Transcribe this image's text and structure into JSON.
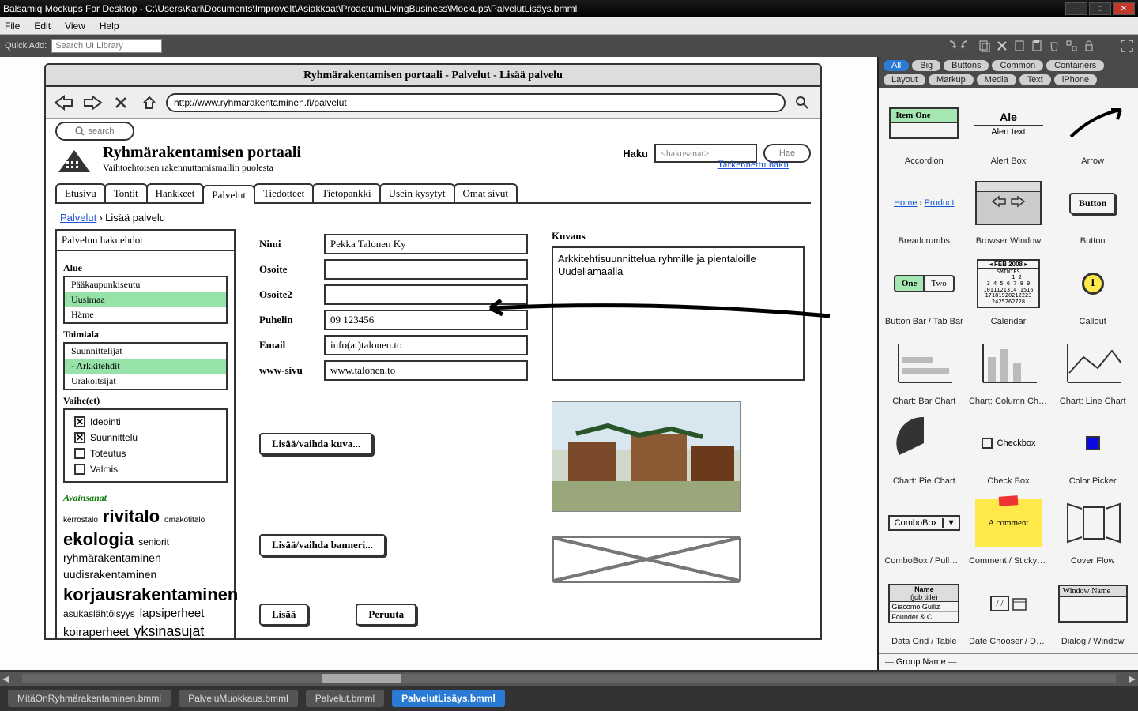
{
  "window": {
    "title": "Balsamiq Mockups For Desktop - C:\\Users\\Kari\\Documents\\ImproveIt\\Asiakkaat\\Proactum\\LivingBusiness\\Mockups\\PalvelutLisäys.bmml"
  },
  "menu": [
    "File",
    "Edit",
    "View",
    "Help"
  ],
  "quickadd": {
    "label": "Quick Add:",
    "placeholder": "Search UI Library"
  },
  "browser": {
    "title": "Ryhmärakentamisen portaali - Palvelut - Lisää palvelu",
    "url": "http://www.ryhmarakentaminen.fi/palvelut",
    "search_placeholder": "search"
  },
  "page": {
    "title": "Ryhmärakentamisen portaali",
    "subtitle": "Vaihtoehtoisen rakennuttamismallin puolesta",
    "haku_label": "Haku",
    "haku_placeholder": "<hakusanat>",
    "hae_btn": "Hae",
    "advanced": "Tarkennettu haku"
  },
  "tabs": [
    "Etusivu",
    "Tontit",
    "Hankkeet",
    "Palvelut",
    "Tiedotteet",
    "Tietopankki",
    "Usein kysytyt",
    "Omat sivut"
  ],
  "active_tab": 3,
  "breadcrumb": {
    "link": "Palvelut",
    "sep": "›",
    "current": "Lisää palvelu"
  },
  "sidebar": {
    "heading": "Palvelun hakuehdot",
    "alue": {
      "label": "Alue",
      "items": [
        "Pääkaupunkiseutu",
        "Uusimaa",
        "Häme"
      ],
      "selected": 1
    },
    "toimiala": {
      "label": "Toimiala",
      "items": [
        "Suunnittelijat",
        "- Arkkitehdit",
        "Urakoitsijat"
      ],
      "selected": 1
    },
    "vaihe": {
      "label": "Vaihe(et)",
      "items": [
        {
          "label": "Ideointi",
          "checked": true
        },
        {
          "label": "Suunnittelu",
          "checked": true
        },
        {
          "label": "Toteutus",
          "checked": false
        },
        {
          "label": "Valmis",
          "checked": false
        }
      ]
    },
    "avainsanat": {
      "label": "Avainsanat",
      "tags": [
        {
          "t": "kerrostalo",
          "s": 10
        },
        {
          "t": "rivitalo",
          "s": 22
        },
        {
          "t": "omakotitalo",
          "s": 10
        },
        {
          "t": "ekologia",
          "s": 22
        },
        {
          "t": "seniorit",
          "s": 12
        },
        {
          "t": "ryhmärakentaminen",
          "s": 14
        },
        {
          "t": "uudisrakentaminen",
          "s": 14
        },
        {
          "t": "korjausrakentaminen",
          "s": 22
        },
        {
          "t": "asukaslähtöisyys",
          "s": 12
        },
        {
          "t": "lapsiperheet",
          "s": 15
        },
        {
          "t": "koiraperheet",
          "s": 15
        },
        {
          "t": "yksinasujat",
          "s": 18
        }
      ]
    }
  },
  "form": {
    "nimi": {
      "label": "Nimi",
      "value": "Pekka Talonen Ky"
    },
    "osoite": {
      "label": "Osoite",
      "value": ""
    },
    "osoite2": {
      "label": "Osoite2",
      "value": ""
    },
    "puhelin": {
      "label": "Puhelin",
      "value": "09 123456"
    },
    "email": {
      "label": "Email",
      "value": "info(at)talonen.to"
    },
    "www": {
      "label": "www-sivu",
      "value": "www.talonen.to"
    },
    "img_btn": "Lisää/vaihda kuva...",
    "banner_btn": "Lisää/vaihda banneri...",
    "submit": "Lisää",
    "cancel": "Peruuta"
  },
  "kuvaus": {
    "label": "Kuvaus",
    "text": "Arkkitehtisuunnittelua ryhmille ja pientaloille Uudellamaalla"
  },
  "doctabs": [
    "MitäOnRyhmärakentaminen.bmml",
    "PalveluMuokkaus.bmml",
    "Palvelut.bmml",
    "PalvelutLisäys.bmml"
  ],
  "active_doctab": 3,
  "lib": {
    "cats": [
      "All",
      "Big",
      "Buttons",
      "Common",
      "Containers",
      "Layout",
      "Markup",
      "Media",
      "Text",
      "iPhone"
    ],
    "active_cat": 0,
    "items": [
      "Accordion",
      "Alert Box",
      "Arrow",
      "Breadcrumbs",
      "Browser Window",
      "Button",
      "Button Bar / Tab Bar",
      "Calendar",
      "Callout",
      "Chart: Bar Chart",
      "Chart: Column Chart",
      "Chart: Line Chart",
      "Chart: Pie Chart",
      "Check Box",
      "Color Picker",
      "ComboBox / PullDo…",
      "Comment / Sticky N…",
      "Cover Flow",
      "Data Grid / Table",
      "Date Chooser / Dat…",
      "Dialog / Window"
    ],
    "preview": {
      "accordion": "Item One",
      "alert_title": "Ale",
      "alert_text": "Alert text",
      "bc_home": "Home",
      "bc_product": "Product",
      "button": "Button",
      "bbar_one": "One",
      "bbar_two": "Two",
      "cal_month": "FEB 2008",
      "callout": "1",
      "checkbox": "Checkbox",
      "combo": "ComboBox",
      "comment": "A comment",
      "grid_name": "Name",
      "grid_job": "(job title)",
      "grid_row": "Giacomo Guiliz",
      "grid_row2": "Founder & C",
      "date": "/   /",
      "dialog": "Window Name",
      "group": "Group Name"
    }
  }
}
